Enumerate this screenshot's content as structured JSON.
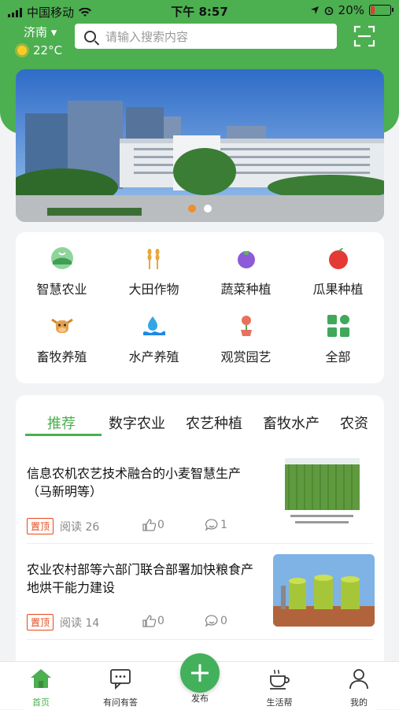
{
  "status": {
    "carrier": "中国移动",
    "time": "下午 8:57",
    "battery": "20%"
  },
  "header": {
    "city": "济南",
    "weather_temp": "22°C",
    "search_placeholder": "请输入搜索内容"
  },
  "categories": [
    {
      "label": "智慧农业",
      "icon": "smart-agriculture-icon"
    },
    {
      "label": "大田作物",
      "icon": "wheat-icon"
    },
    {
      "label": "蔬菜种植",
      "icon": "eggplant-icon"
    },
    {
      "label": "瓜果种植",
      "icon": "apple-icon"
    },
    {
      "label": "畜牧养殖",
      "icon": "cow-icon"
    },
    {
      "label": "水产养殖",
      "icon": "fish-water-icon"
    },
    {
      "label": "观赏园艺",
      "icon": "flower-pot-icon"
    },
    {
      "label": "全部",
      "icon": "grid-icon"
    }
  ],
  "tabs": [
    "推荐",
    "数字农业",
    "农艺种植",
    "畜牧水产",
    "农资"
  ],
  "articles": [
    {
      "title": "信息农机农艺技术融合的小麦智慧生产（马新明等）",
      "tag": "置顶",
      "reads": "阅读 26",
      "likes": "0",
      "comments": "1"
    },
    {
      "title": "农业农村部等六部门联合部署加快粮食产地烘干能力建设",
      "tag": "置顶",
      "reads": "阅读 14",
      "likes": "0",
      "comments": "0"
    }
  ],
  "tabbar": [
    {
      "label": "首页",
      "icon": "home-icon"
    },
    {
      "label": "有问有答",
      "icon": "chat-icon"
    },
    {
      "label": "发布",
      "icon": "add-icon"
    },
    {
      "label": "生活帮",
      "icon": "coffee-icon"
    },
    {
      "label": "我的",
      "icon": "user-icon"
    }
  ],
  "colors": {
    "brand": "#4caf50",
    "tag": "#e64a19",
    "banner_dot_active": "#ef8f2d"
  }
}
